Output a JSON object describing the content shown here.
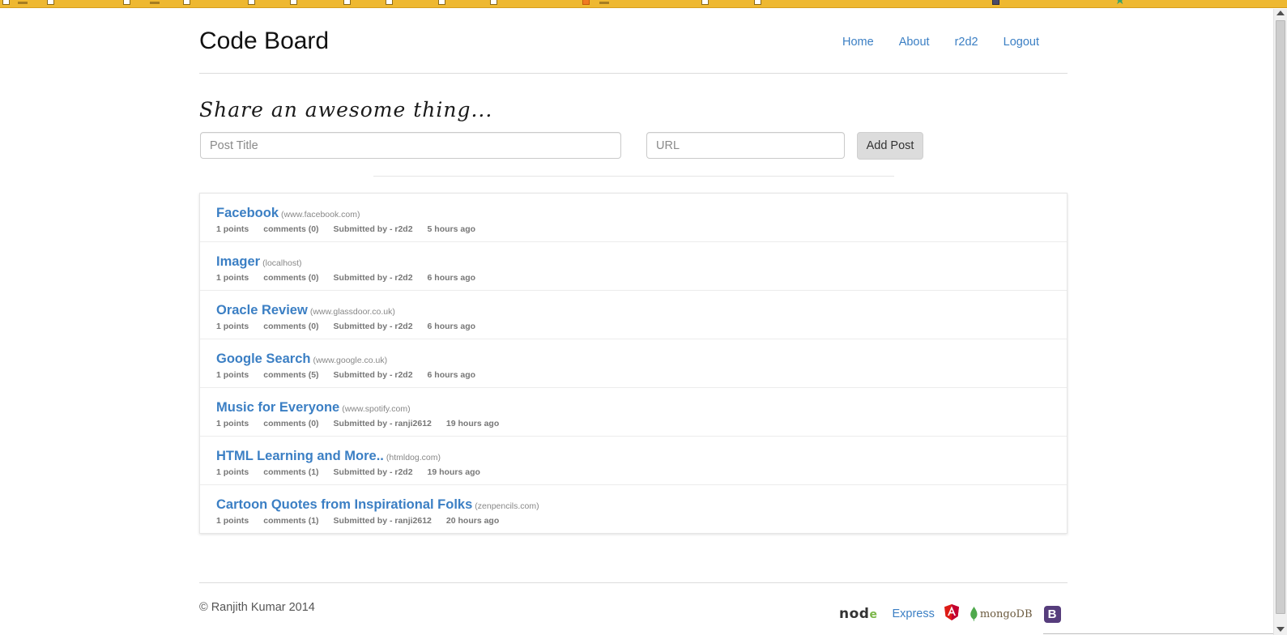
{
  "header": {
    "brand": "Code Board",
    "nav": [
      {
        "label": "Home"
      },
      {
        "label": "About"
      },
      {
        "label": "r2d2"
      },
      {
        "label": "Logout"
      }
    ]
  },
  "share": {
    "heading": "Share an awesome thing...",
    "title_placeholder": "Post Title",
    "title_value": "",
    "url_placeholder": "URL",
    "url_value": "",
    "add_label": "Add Post"
  },
  "posts": [
    {
      "title": "Facebook",
      "domain": "(www.facebook.com)",
      "points": "1 points",
      "comments": "comments (0)",
      "submitted": "Submitted by - r2d2",
      "time": "5 hours ago"
    },
    {
      "title": "Imager",
      "domain": "(localhost)",
      "points": "1 points",
      "comments": "comments (0)",
      "submitted": "Submitted by - r2d2",
      "time": "6 hours ago"
    },
    {
      "title": "Oracle Review",
      "domain": "(www.glassdoor.co.uk)",
      "points": "1 points",
      "comments": "comments (0)",
      "submitted": "Submitted by - r2d2",
      "time": "6 hours ago"
    },
    {
      "title": "Google Search",
      "domain": "(www.google.co.uk)",
      "points": "1 points",
      "comments": "comments (5)",
      "submitted": "Submitted by - r2d2",
      "time": "6 hours ago"
    },
    {
      "title": "Music for Everyone",
      "domain": "(www.spotify.com)",
      "points": "1 points",
      "comments": "comments (0)",
      "submitted": "Submitted by - ranji2612",
      "time": "19 hours ago"
    },
    {
      "title": "HTML Learning and More..",
      "domain": "(htmldog.com)",
      "points": "1 points",
      "comments": "comments (1)",
      "submitted": "Submitted by - r2d2",
      "time": "19 hours ago"
    },
    {
      "title": "Cartoon Quotes from Inspirational Folks",
      "domain": "(zenpencils.com)",
      "points": "1 points",
      "comments": "comments (1)",
      "submitted": "Submitted by - ranji2612",
      "time": "20 hours ago"
    }
  ],
  "footer": {
    "copyright": "© Ranjith Kumar 2014",
    "node_logo": "nod",
    "node_logo_dot": "e",
    "express_label": "Express",
    "mongo_label": "mongoDB",
    "bootstrap_letter": "B",
    "icons": [
      "node-logo-icon",
      "angular-icon",
      "mongodb-leaf-icon",
      "bootstrap-icon"
    ]
  },
  "colors": {
    "link": "#3b7fc4",
    "bookmark_bar": "#eeb831",
    "button_bg": "#dcdcdc",
    "bootstrap": "#563d7c",
    "angular": "#dd1b16",
    "mongo_leaf": "#4fa94d",
    "node_green": "#7ab648"
  }
}
